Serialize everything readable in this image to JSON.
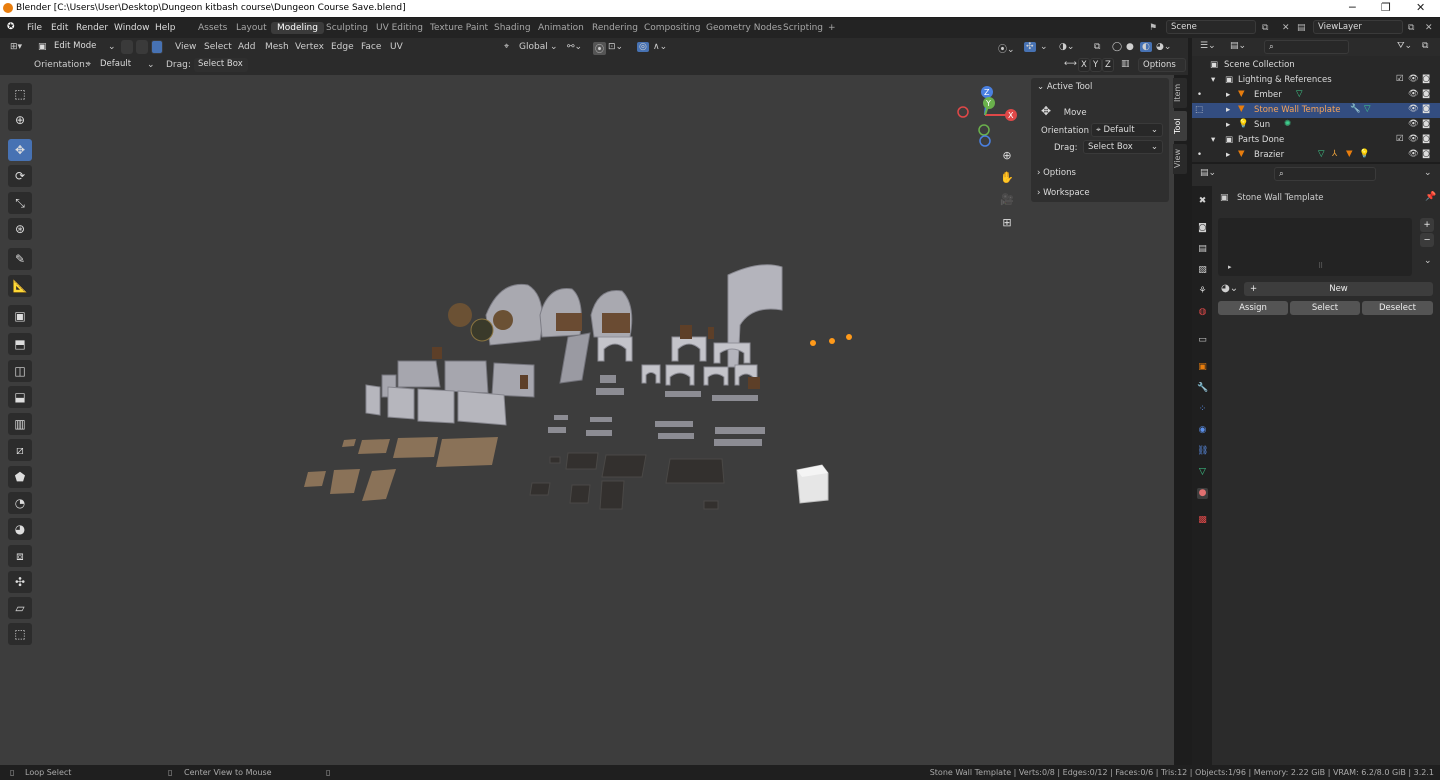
{
  "window": {
    "title": "Blender [C:\\Users\\User\\Desktop\\Dungeon kitbash course\\Dungeon Course Save.blend]",
    "minimize": "─",
    "maximize": "❐",
    "close": "✕"
  },
  "menus": [
    "File",
    "Edit",
    "Render",
    "Window",
    "Help"
  ],
  "workspaces": [
    "Assets",
    "Layout",
    "Modeling",
    "Sculpting",
    "UV Editing",
    "Texture Paint",
    "Shading",
    "Animation",
    "Rendering",
    "Compositing",
    "Geometry Nodes",
    "Scripting",
    "+"
  ],
  "active_workspace": "Modeling",
  "scene": {
    "label": "Scene",
    "viewlayer": "ViewLayer"
  },
  "header": {
    "mode": "Edit Mode",
    "menus": [
      "View",
      "Select",
      "Add",
      "Mesh",
      "Vertex",
      "Edge",
      "Face",
      "UV"
    ],
    "transform_orientation": "Global",
    "options_label": "Options",
    "axes": [
      "X",
      "Y",
      "Z"
    ]
  },
  "header2": {
    "orientation_label": "Orientation:",
    "orientation_value": "Default",
    "drag_label": "Drag:",
    "drag_value": "Select Box"
  },
  "npanel": {
    "active_tool_title": "Active Tool",
    "tool_name": "Move",
    "orientation_label": "Orientation",
    "orientation_value": "Default",
    "drag_label": "Drag:",
    "drag_value": "Select Box",
    "options": "Options",
    "workspace": "Workspace",
    "tabs": [
      "Item",
      "Tool",
      "View"
    ]
  },
  "gizmo": {
    "z": "Z",
    "y": "Y",
    "x": "X"
  },
  "outliner": {
    "rows": [
      {
        "label": "Scene Collection"
      },
      {
        "label": "Lighting & References"
      },
      {
        "label": "Ember"
      },
      {
        "label": "Stone Wall Template"
      },
      {
        "label": "Sun"
      },
      {
        "label": "Parts Done"
      },
      {
        "label": "Brazier"
      }
    ]
  },
  "properties": {
    "object_name": "Stone Wall Template",
    "new_button": "New",
    "assign": "Assign",
    "select": "Select",
    "deselect": "Deselect",
    "plus": "+",
    "minus": "−"
  },
  "status": {
    "left": "Loop Select",
    "middle": "Center View to Mouse",
    "right": "Stone Wall Template | Verts:0/8 | Edges:0/12 | Faces:0/6 | Tris:12 | Objects:1/96 | Memory: 2.22 GiB | VRAM: 6.2/8.0 GiB | 3.2.1"
  },
  "colors": {
    "accent": "#4772b3",
    "selection": "#334d80",
    "orange": "#e87d0d",
    "viewport": "#3d3d3d"
  }
}
